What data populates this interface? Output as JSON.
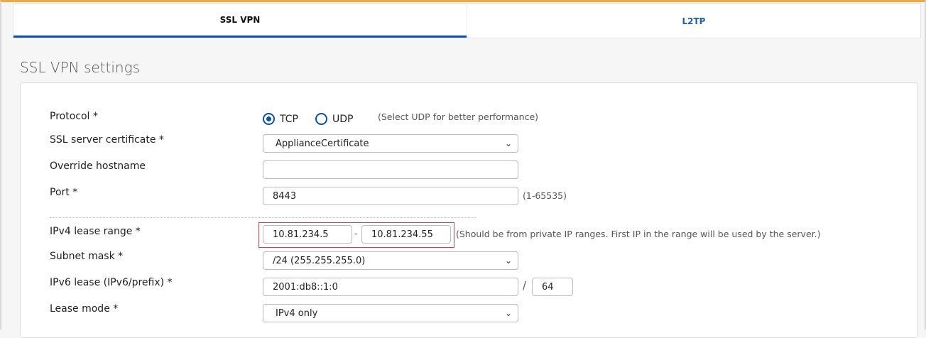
{
  "tabs": [
    {
      "label": "SSL VPN",
      "active": true
    },
    {
      "label": "L2TP",
      "active": false
    }
  ],
  "section_title": "SSL VPN settings",
  "form": {
    "protocol": {
      "label": "Protocol *",
      "options": [
        "TCP",
        "UDP"
      ],
      "selected": "TCP",
      "hint": "(Select UDP for better performance)"
    },
    "certificate": {
      "label": "SSL server certificate *",
      "value": "ApplianceCertificate"
    },
    "hostname": {
      "label": "Override hostname",
      "value": ""
    },
    "port": {
      "label": "Port *",
      "value": "8443",
      "hint": "(1-65535)"
    },
    "ipv4_range": {
      "label": "IPv4 lease range *",
      "start": "10.81.234.5",
      "separator": "-",
      "end": "10.81.234.55",
      "hint": "(Should be from private IP ranges. First IP in the range will be used by the server.)"
    },
    "subnet": {
      "label": "Subnet mask *",
      "value": "/24 (255.255.255.0)"
    },
    "ipv6": {
      "label": "IPv6 lease (IPv6/prefix) *",
      "value": "2001:db8::1:0",
      "separator": "/",
      "prefix": "64"
    },
    "lease_mode": {
      "label": "Lease mode *",
      "value": "IPv4 only"
    }
  },
  "colors": {
    "accent": "#0a4fa8",
    "highlight_box": "#d04050",
    "top_bar": "#f0a840"
  }
}
